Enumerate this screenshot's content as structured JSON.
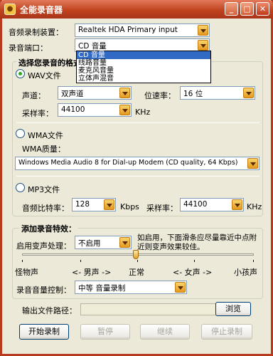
{
  "window": {
    "title": "全能录音器",
    "icon_glyph": "●",
    "min_glyph": "_",
    "max_glyph": "□",
    "close_glyph": "✕"
  },
  "device": {
    "label": "音频录制装置：",
    "value": "Realtek HDA Primary input"
  },
  "port": {
    "label": "录音端口：",
    "value": "CD 音量",
    "options": [
      "CD 音量",
      "线路音量",
      "麦克风音量",
      "立体声混音"
    ]
  },
  "format_group": {
    "title": "选择您录音的格式",
    "wav": {
      "label": "WAV文件",
      "channel_label": "声道：",
      "channel_value": "双声道",
      "bitrate_label": "位速率：",
      "bitrate_value": "16 位",
      "samplerate_label": "采样率：",
      "samplerate_value": "44100",
      "samplerate_unit": "KHz"
    },
    "wma": {
      "label": "WMA文件",
      "quality_label": "WMA质量：",
      "quality_value": "Windows Media Audio 8 for Dial-up Modem (CD quality, 64 Kbps)"
    },
    "mp3": {
      "label": "MP3文件",
      "bitrate_label": "音频比特率：",
      "bitrate_value": "128",
      "bitrate_unit": "Kbps",
      "samplerate_label": "采样率：",
      "samplerate_value": "44100",
      "samplerate_unit": "KHz"
    }
  },
  "effects": {
    "title": "添加录音特效：",
    "voice_label": "启用变声处理：",
    "voice_value": "不启用",
    "hint": "如启用，下面滑条应尽量靠近中点附近则变声效果较佳。",
    "slider": {
      "left": "怪物声",
      "male": "<- 男声 ->",
      "normal": "正常",
      "female": "<- 女声 ->",
      "right": "小孩声",
      "value": 0.5
    },
    "volume_label": "录音音量控制：",
    "volume_value": "中等 音量录制"
  },
  "output": {
    "label": "输出文件路径：",
    "browse": "浏览"
  },
  "actions": {
    "start": "开始录制",
    "pause": "暂停",
    "resume": "继续",
    "stop": "停止录制"
  }
}
